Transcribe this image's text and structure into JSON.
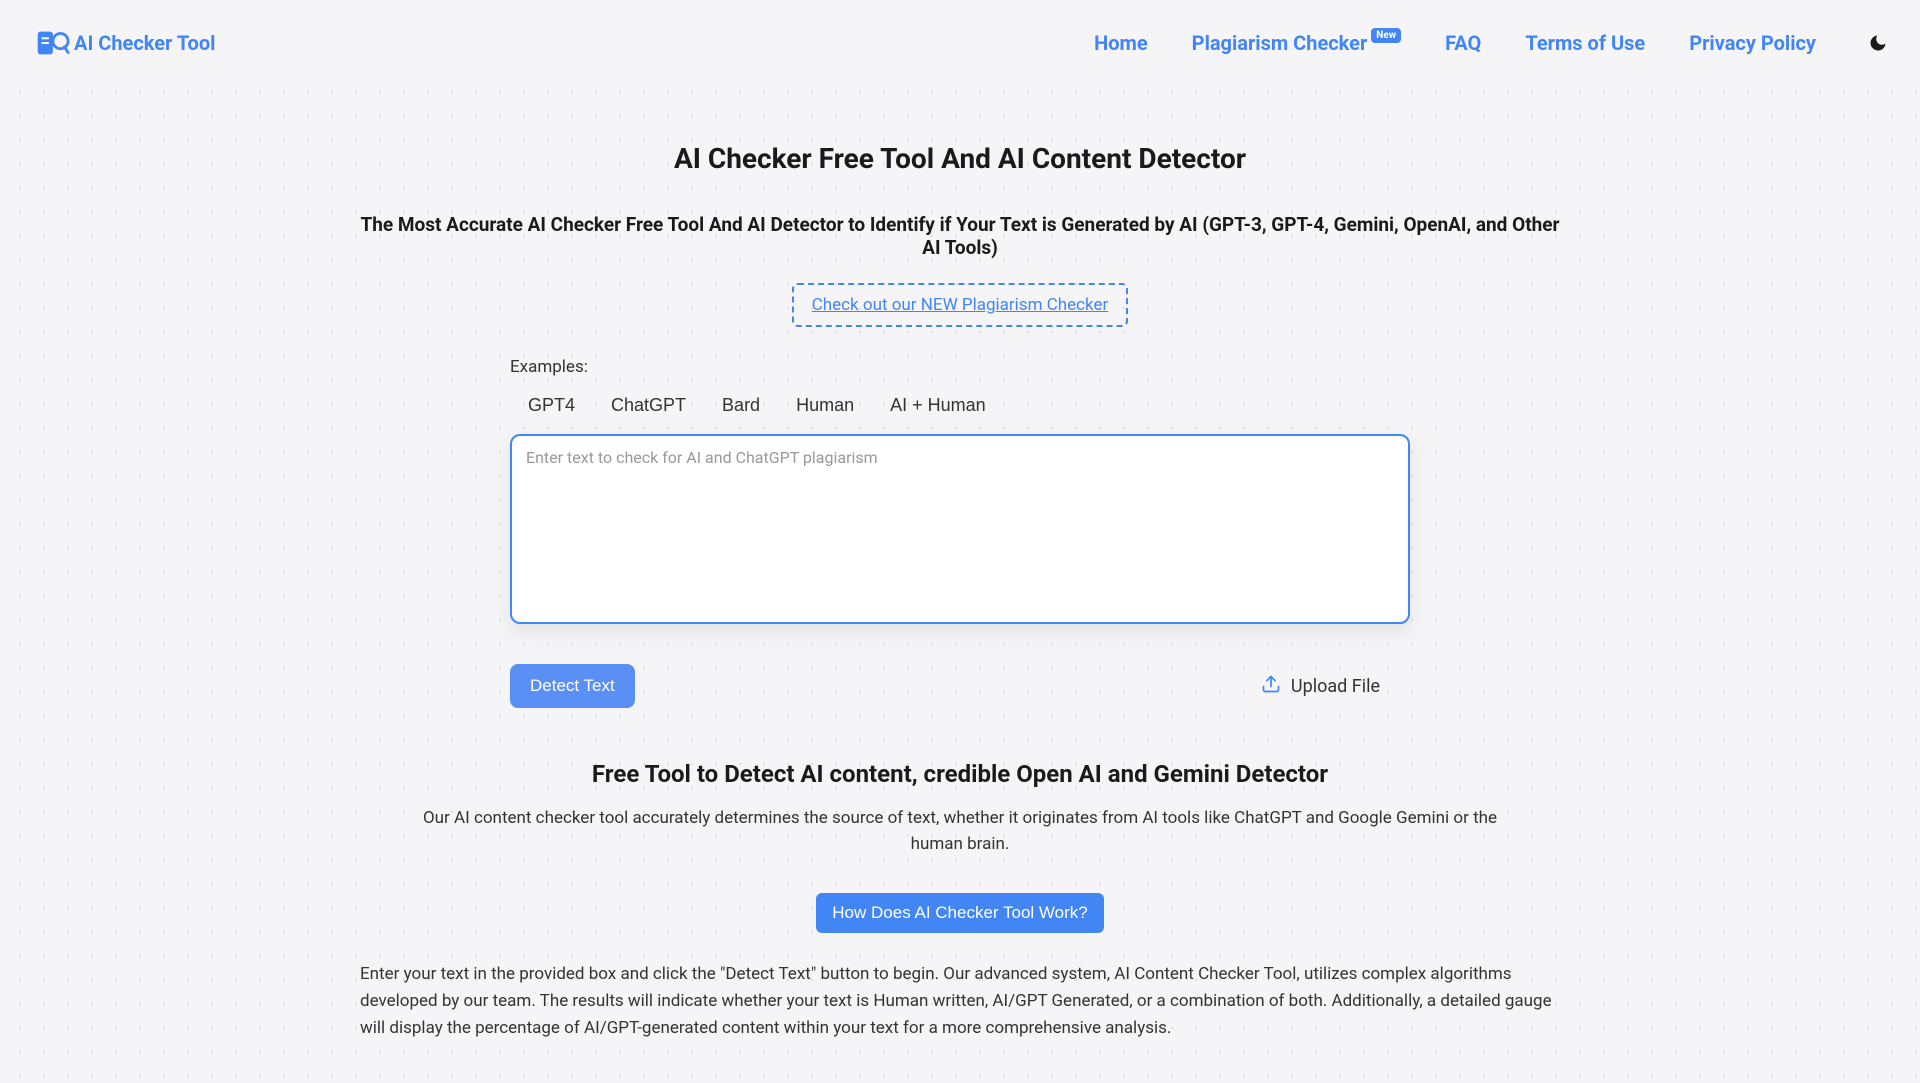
{
  "brand": {
    "name": "AI Checker Tool"
  },
  "nav": {
    "home": "Home",
    "plagiarism": "Plagiarism Checker",
    "plagiarism_badge": "New",
    "faq": "FAQ",
    "terms": "Terms of Use",
    "privacy": "Privacy Policy"
  },
  "hero": {
    "title": "AI Checker Free Tool And AI Content Detector",
    "subtitle": "The Most Accurate AI Checker Free Tool And AI Detector to Identify if Your Text is Generated by AI (GPT-3, GPT-4, Gemini, OpenAI, and Other AI Tools)",
    "banner_link": "Check out our NEW Plagiarism Checker"
  },
  "editor": {
    "examples_label": "Examples:",
    "examples": [
      "GPT4",
      "ChatGPT",
      "Bard",
      "Human",
      "AI + Human"
    ],
    "placeholder": "Enter text to check for AI and ChatGPT plagiarism",
    "detect_button": "Detect Text",
    "upload_label": "Upload File"
  },
  "section2": {
    "heading": "Free Tool to Detect AI content, credible Open AI and Gemini Detector",
    "intro": "Our AI content checker tool accurately determines the source of text, whether it originates from AI tools like ChatGPT and Google Gemini or the human brain.",
    "cta": "How Does AI Checker Tool Work?",
    "body": "Enter your text in the provided box and click the \"Detect Text\" button to begin. Our advanced system, AI Content Checker Tool, utilizes complex algorithms developed by our team. The results will indicate whether your text is Human written, AI/GPT Generated, or a combination of both. Additionally, a detailed gauge will display the percentage of AI/GPT-generated content within your text for a more comprehensive analysis."
  }
}
